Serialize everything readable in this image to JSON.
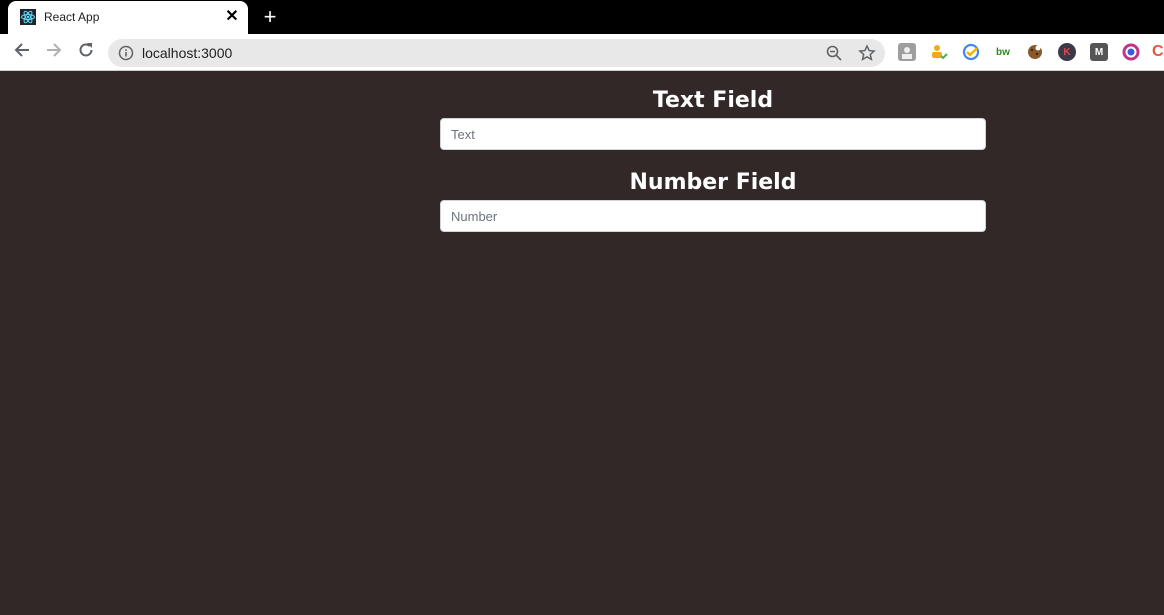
{
  "browser": {
    "tab": {
      "title": "React App",
      "close_glyph": "✕",
      "favicon": "react-icon"
    },
    "new_tab_glyph": "+",
    "address": {
      "url": "localhost:3000"
    },
    "extensions": [
      {
        "name": "profile-extension-icon",
        "label": ""
      },
      {
        "name": "todo-extension-icon",
        "label": ""
      },
      {
        "name": "check-extension-icon",
        "label": ""
      },
      {
        "name": "bw-extension-icon",
        "label": "bw"
      },
      {
        "name": "cookie-extension-icon",
        "label": ""
      },
      {
        "name": "k-extension-icon",
        "label": "K"
      },
      {
        "name": "m-extension-icon",
        "label": "M"
      },
      {
        "name": "color-ring-extension-icon",
        "label": ""
      },
      {
        "name": "c-extension-icon",
        "label": "C"
      }
    ]
  },
  "form": {
    "text_field": {
      "label": "Text Field",
      "placeholder": "Text",
      "value": ""
    },
    "number_field": {
      "label": "Number Field",
      "placeholder": "Number",
      "value": ""
    }
  },
  "colors": {
    "page_background": "#332828",
    "tab_strip": "#000000"
  }
}
